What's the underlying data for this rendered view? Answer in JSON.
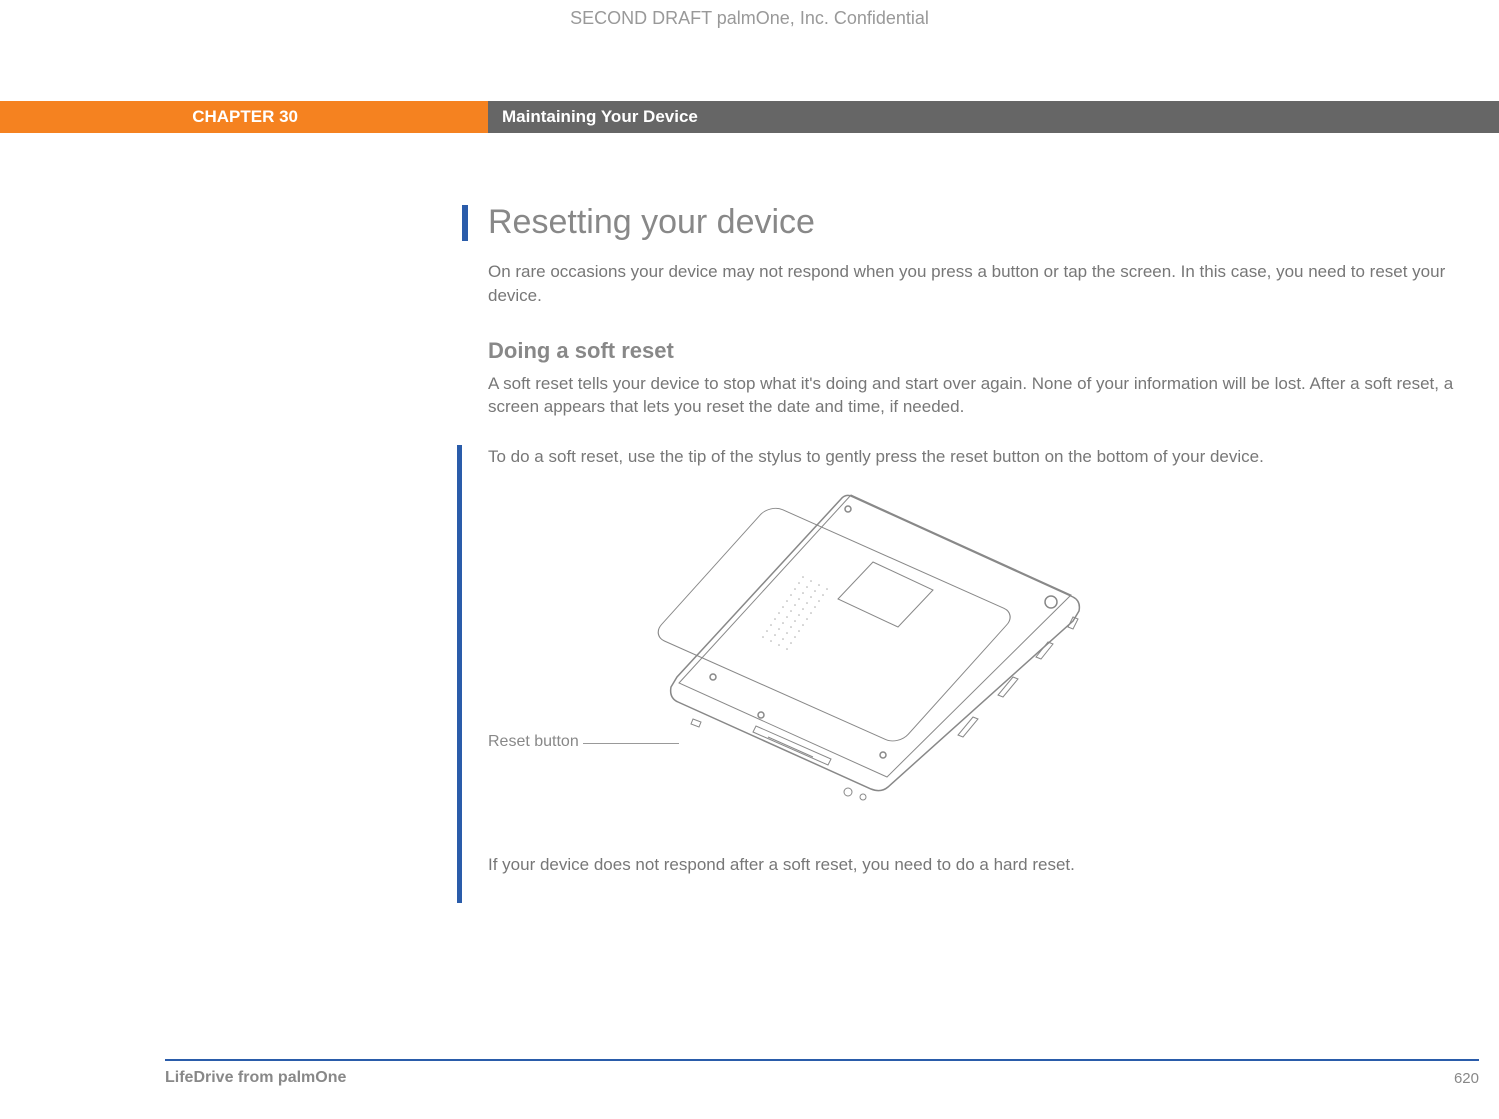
{
  "header": {
    "draft_notice": "SECOND DRAFT palmOne, Inc.  Confidential"
  },
  "chapter": {
    "label": "CHAPTER 30",
    "title": "Maintaining Your Device"
  },
  "section": {
    "title": "Resetting your device",
    "intro": "On rare occasions your device may not respond when you press a button or tap the screen. In this case, you need to reset your device."
  },
  "subsection": {
    "title": "Doing a soft reset",
    "description": "A soft reset tells your device to stop what it's doing and start over again. None of your information will be lost. After a soft reset, a screen appears that lets you reset the date and time, if needed.",
    "instruction": "To do a soft reset, use the tip of the stylus to gently press the reset button on the bottom of your device.",
    "followup": "If your device does not respond after a soft reset, you need to do a hard reset."
  },
  "figure": {
    "callout_label": "Reset button"
  },
  "footer": {
    "product": "LifeDrive from palmOne",
    "page_number": "620"
  }
}
